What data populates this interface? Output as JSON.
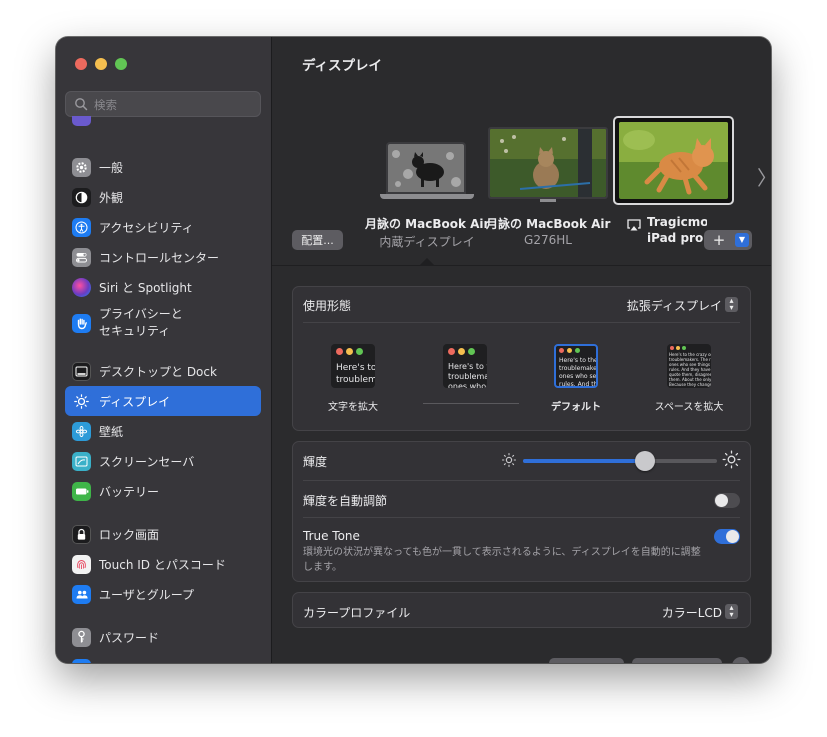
{
  "window": {
    "traffic_lights": [
      {
        "name": "close",
        "color": "#ed6a5e"
      },
      {
        "name": "minimize",
        "color": "#f5bf4f"
      },
      {
        "name": "zoom",
        "color": "#61c554"
      }
    ]
  },
  "sidebar": {
    "search_placeholder": "検索",
    "items": [
      {
        "label": "一般",
        "icon": "gear-icon",
        "color": "#8e8e93"
      },
      {
        "label": "外観",
        "icon": "appearance-icon",
        "color": "#1c1c1e"
      },
      {
        "label": "アクセシビリティ",
        "icon": "accessibility-icon",
        "color": "#1e7cf2"
      },
      {
        "label": "コントロールセンター",
        "icon": "control-center-icon",
        "color": "#8e8e93"
      },
      {
        "label": "Siri と Spotlight",
        "icon": "siri-icon",
        "color": "#6a3cc2"
      },
      {
        "label": "プライバシーと\nセキュリティ",
        "icon": "privacy-hand-icon",
        "color": "#1e7cf2"
      },
      {
        "label": "デスクトップと Dock",
        "icon": "dock-icon",
        "color": "#1c1c1e"
      },
      {
        "label": "ディスプレイ",
        "icon": "display-sun-icon",
        "color": "#2f6fd9"
      },
      {
        "label": "壁紙",
        "icon": "wallpaper-icon",
        "color": "#2d9bd8"
      },
      {
        "label": "スクリーンセーバ",
        "icon": "screensaver-icon",
        "color": "#3ab0c8"
      },
      {
        "label": "バッテリー",
        "icon": "battery-icon",
        "color": "#3fb549"
      },
      {
        "label": "ロック画面",
        "icon": "lock-icon",
        "color": "#1c1c1e"
      },
      {
        "label": "Touch ID とパスコード",
        "icon": "fingerprint-icon",
        "color": "#f2f2f2"
      },
      {
        "label": "ユーザとグループ",
        "icon": "users-icon",
        "color": "#1e7cf2"
      },
      {
        "label": "パスワード",
        "icon": "key-icon",
        "color": "#8e8e93"
      }
    ],
    "active_index": 7
  },
  "main": {
    "title": "ディスプレイ",
    "arrange_button": "配置...",
    "add_button": "+",
    "displays": [
      {
        "name": "月詠の MacBook Air",
        "sub": "内蔵ディスプレイ"
      },
      {
        "name": "月詠の MacBook Air",
        "sub": "G276HL"
      },
      {
        "name": "Tragicmo",
        "sub": "iPad pro"
      }
    ],
    "usage": {
      "label": "使用形態",
      "value": "拡張ディスプレイ",
      "modes": [
        {
          "caption": "文字を拡大",
          "sample": "Here's to\ntroublem",
          "selected": false
        },
        {
          "caption": "",
          "sample": "Here's to t\ntroublema\nones who",
          "selected": false
        },
        {
          "caption": "デフォルト",
          "sample": "Here's to the cr\ntroublemakers.\nones who see th\nrules. And they",
          "selected": true
        },
        {
          "caption": "スペースを拡大",
          "sample": "Here's to the crazy ones\ntroublemakers. The rou\nones who see things diff\nrules. And they have no r\nquote them, disagree wit\nthem. About the only th\nBecause they change thin",
          "selected": false
        }
      ]
    },
    "brightness": {
      "label": "輝度",
      "level_percent": 63
    },
    "auto_brightness": {
      "label": "輝度を自動調節",
      "enabled": false
    },
    "true_tone": {
      "label": "True Tone",
      "description": "環境光の状況が異なっても色が一貫して表示されるように、ディスプレイを自動的に調整します。",
      "enabled": true
    },
    "color_profile": {
      "label": "カラープロファイル",
      "value": "カラーLCD"
    },
    "accent_color": "#2f6fd9"
  }
}
